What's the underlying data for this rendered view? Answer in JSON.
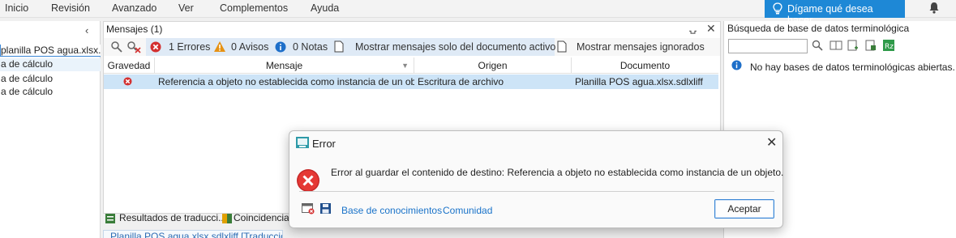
{
  "menubar": {
    "items": [
      "Inicio",
      "Revisión",
      "Avanzado",
      "Ver",
      "Complementos",
      "Ayuda"
    ],
    "tell_me": "Dígame qué desea hacer..."
  },
  "left_panel": {
    "rows": [
      "planilla POS agua.xlsx.sd",
      "a de cálculo",
      "a de cálculo",
      "a de cálculo"
    ]
  },
  "messages": {
    "title": "Mensajes (1)",
    "errors": "1 Errores",
    "warnings": "0 Avisos",
    "notes": "0 Notas",
    "show_active_doc": "Mostrar mensajes solo del documento activo",
    "show_ignored": "Mostrar mensajes ignorados",
    "columns": [
      "Gravedad",
      "Mensaje",
      "Origen",
      "Documento"
    ],
    "rows": [
      {
        "message": "Referencia a objeto no establecida como instancia de un obj...",
        "origin": "Escritura de archivo",
        "document": "Planilla POS agua.xlsx.sdlxliff"
      }
    ],
    "bottom_tabs": [
      "Resultados de traducci...",
      "Coincidencias"
    ],
    "doc_tab": "Planilla POS agua.xlsx.sdlxliff [Traducción]"
  },
  "termbase": {
    "title": "Búsqueda de base de datos terminológica",
    "search_value": "",
    "empty_message": "No hay bases de datos terminológicas abiertas."
  },
  "dialog": {
    "title": "Error",
    "message": "Error al guardar el contenido de destino: Referencia a objeto no establecida como instancia de un objeto.",
    "link_kb": "Base de conocimientos",
    "link_community": "Comunidad",
    "ok": "Aceptar"
  },
  "colors": {
    "accent": "#1e88d6",
    "error_red": "#d32f2f",
    "selected_row": "#cde4f7"
  }
}
